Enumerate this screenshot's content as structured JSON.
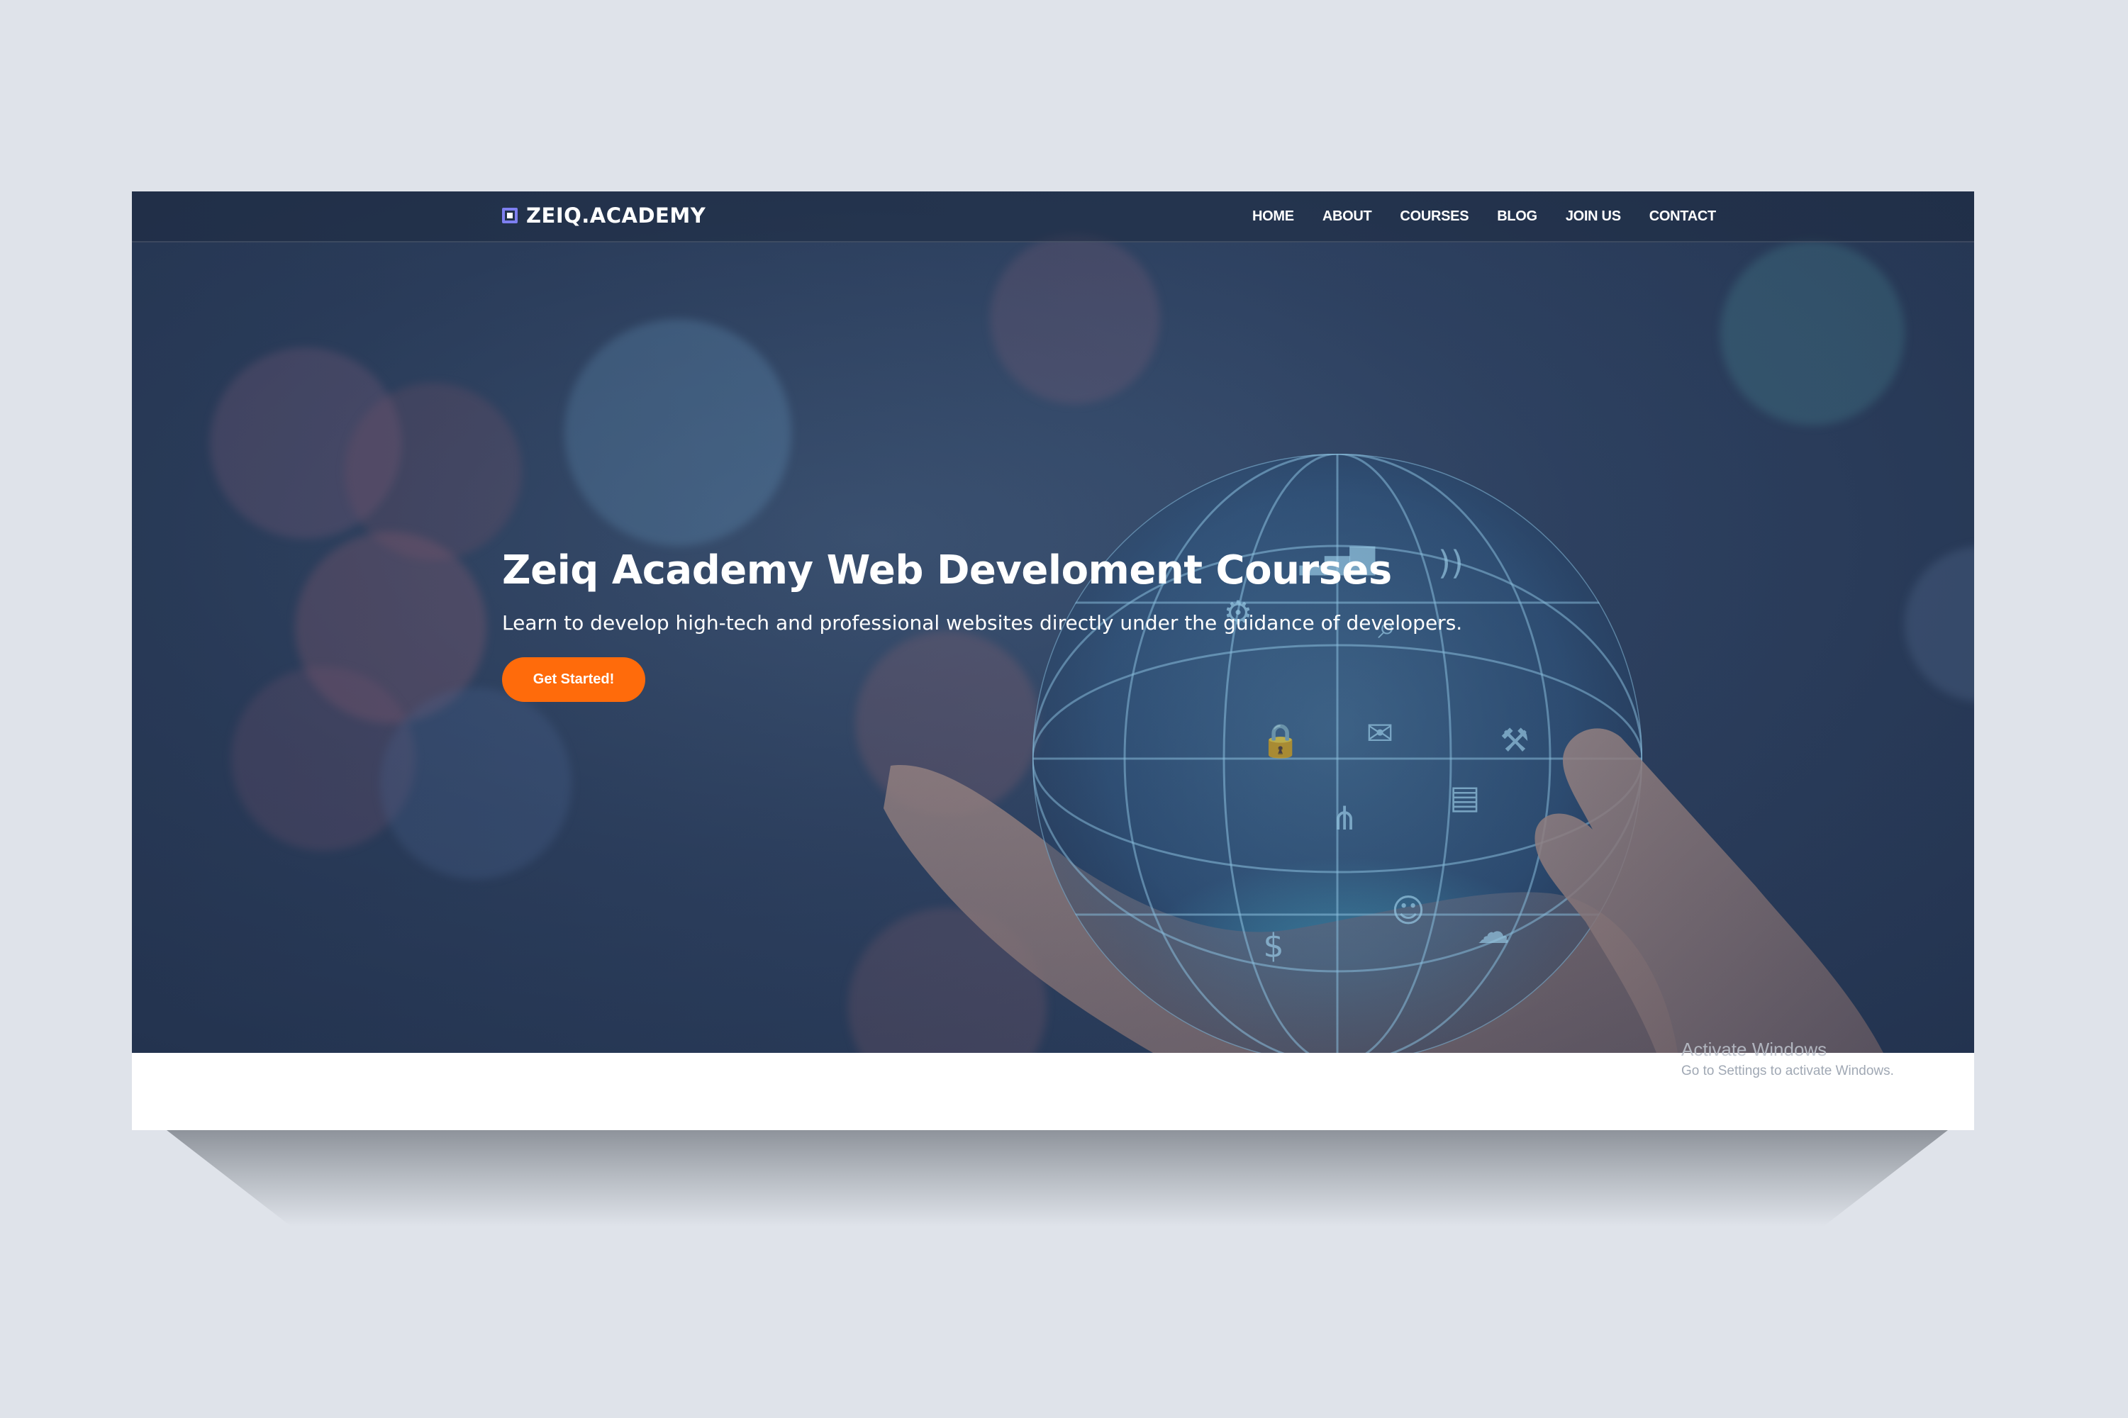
{
  "brand": {
    "name": "ZEIQ.ACADEMY",
    "icon": "academy-logo-icon",
    "icon_color": "#7d7ff0"
  },
  "nav": {
    "items": [
      {
        "label": "HOME"
      },
      {
        "label": "ABOUT"
      },
      {
        "label": "COURSES"
      },
      {
        "label": "BLOG"
      },
      {
        "label": "JOIN US"
      },
      {
        "label": "CONTACT"
      }
    ]
  },
  "hero": {
    "title": "Zeiq Academy Web Develoment Courses",
    "subtitle": "Learn to develop high-tech and professional websites directly under the guidance of developers.",
    "cta_label": "Get Started!",
    "cta_color": "#ff6b0b",
    "background_icons": [
      "globe-icon",
      "lock-icon",
      "gear-icon",
      "mail-icon",
      "search-icon",
      "users-icon",
      "cloud-icon",
      "bar-chart-icon",
      "dollar-icon",
      "wrench-icon",
      "wifi-icon",
      "document-icon",
      "hand-icon"
    ]
  },
  "watermark": {
    "title": "Activate Windows",
    "subtitle": "Go to Settings to activate Windows."
  },
  "colors": {
    "page_background": "#dfe3ea",
    "hero_overlay": "#2f4363",
    "accent": "#ff6b0b"
  }
}
